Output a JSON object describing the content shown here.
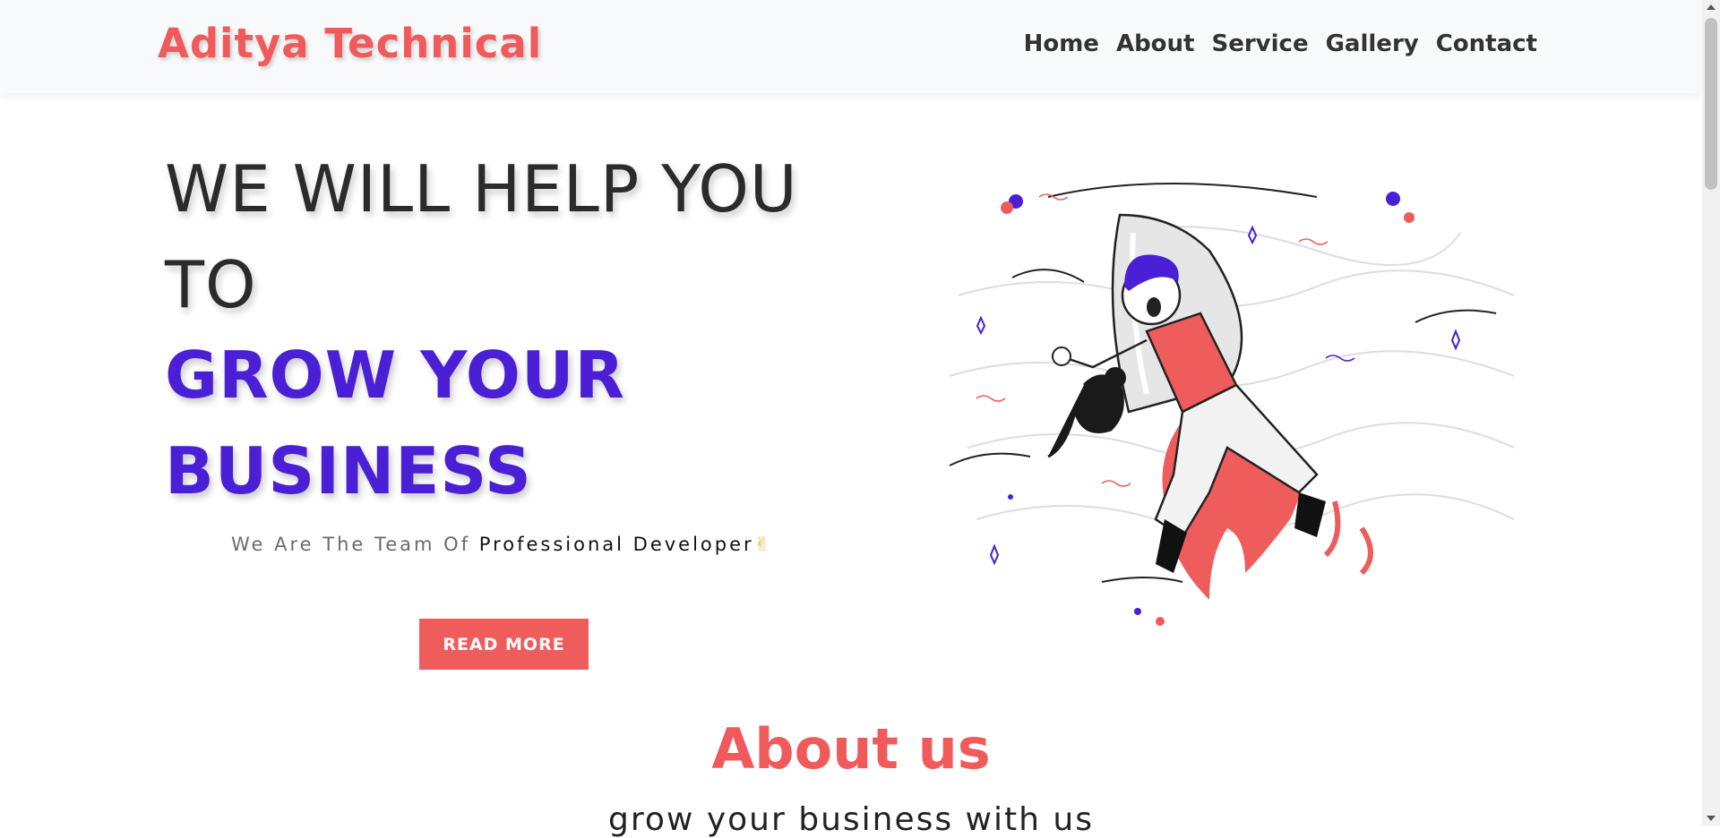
{
  "navbar": {
    "brand": "Aditya Technical",
    "links": [
      "Home",
      "About",
      "Service",
      "Gallery",
      "Contact"
    ]
  },
  "hero": {
    "title_line1": "WE WILL HELP YOU TO",
    "title_line2": "GROW YOUR BUSINESS",
    "tagline_prefix": "We Are The Team Of ",
    "tagline_strong": "Professional Developer",
    "tagline_emoji": "✌",
    "button_label": "READ MORE",
    "illustration": "rocket-man-illustration"
  },
  "about": {
    "heading": "About us",
    "subheading": "grow your business with us"
  },
  "colors": {
    "brand": "#f05a5b",
    "accent": "#4a1fd6",
    "button": "#ee5d5c",
    "navbar_bg": "#f8f9fa"
  }
}
